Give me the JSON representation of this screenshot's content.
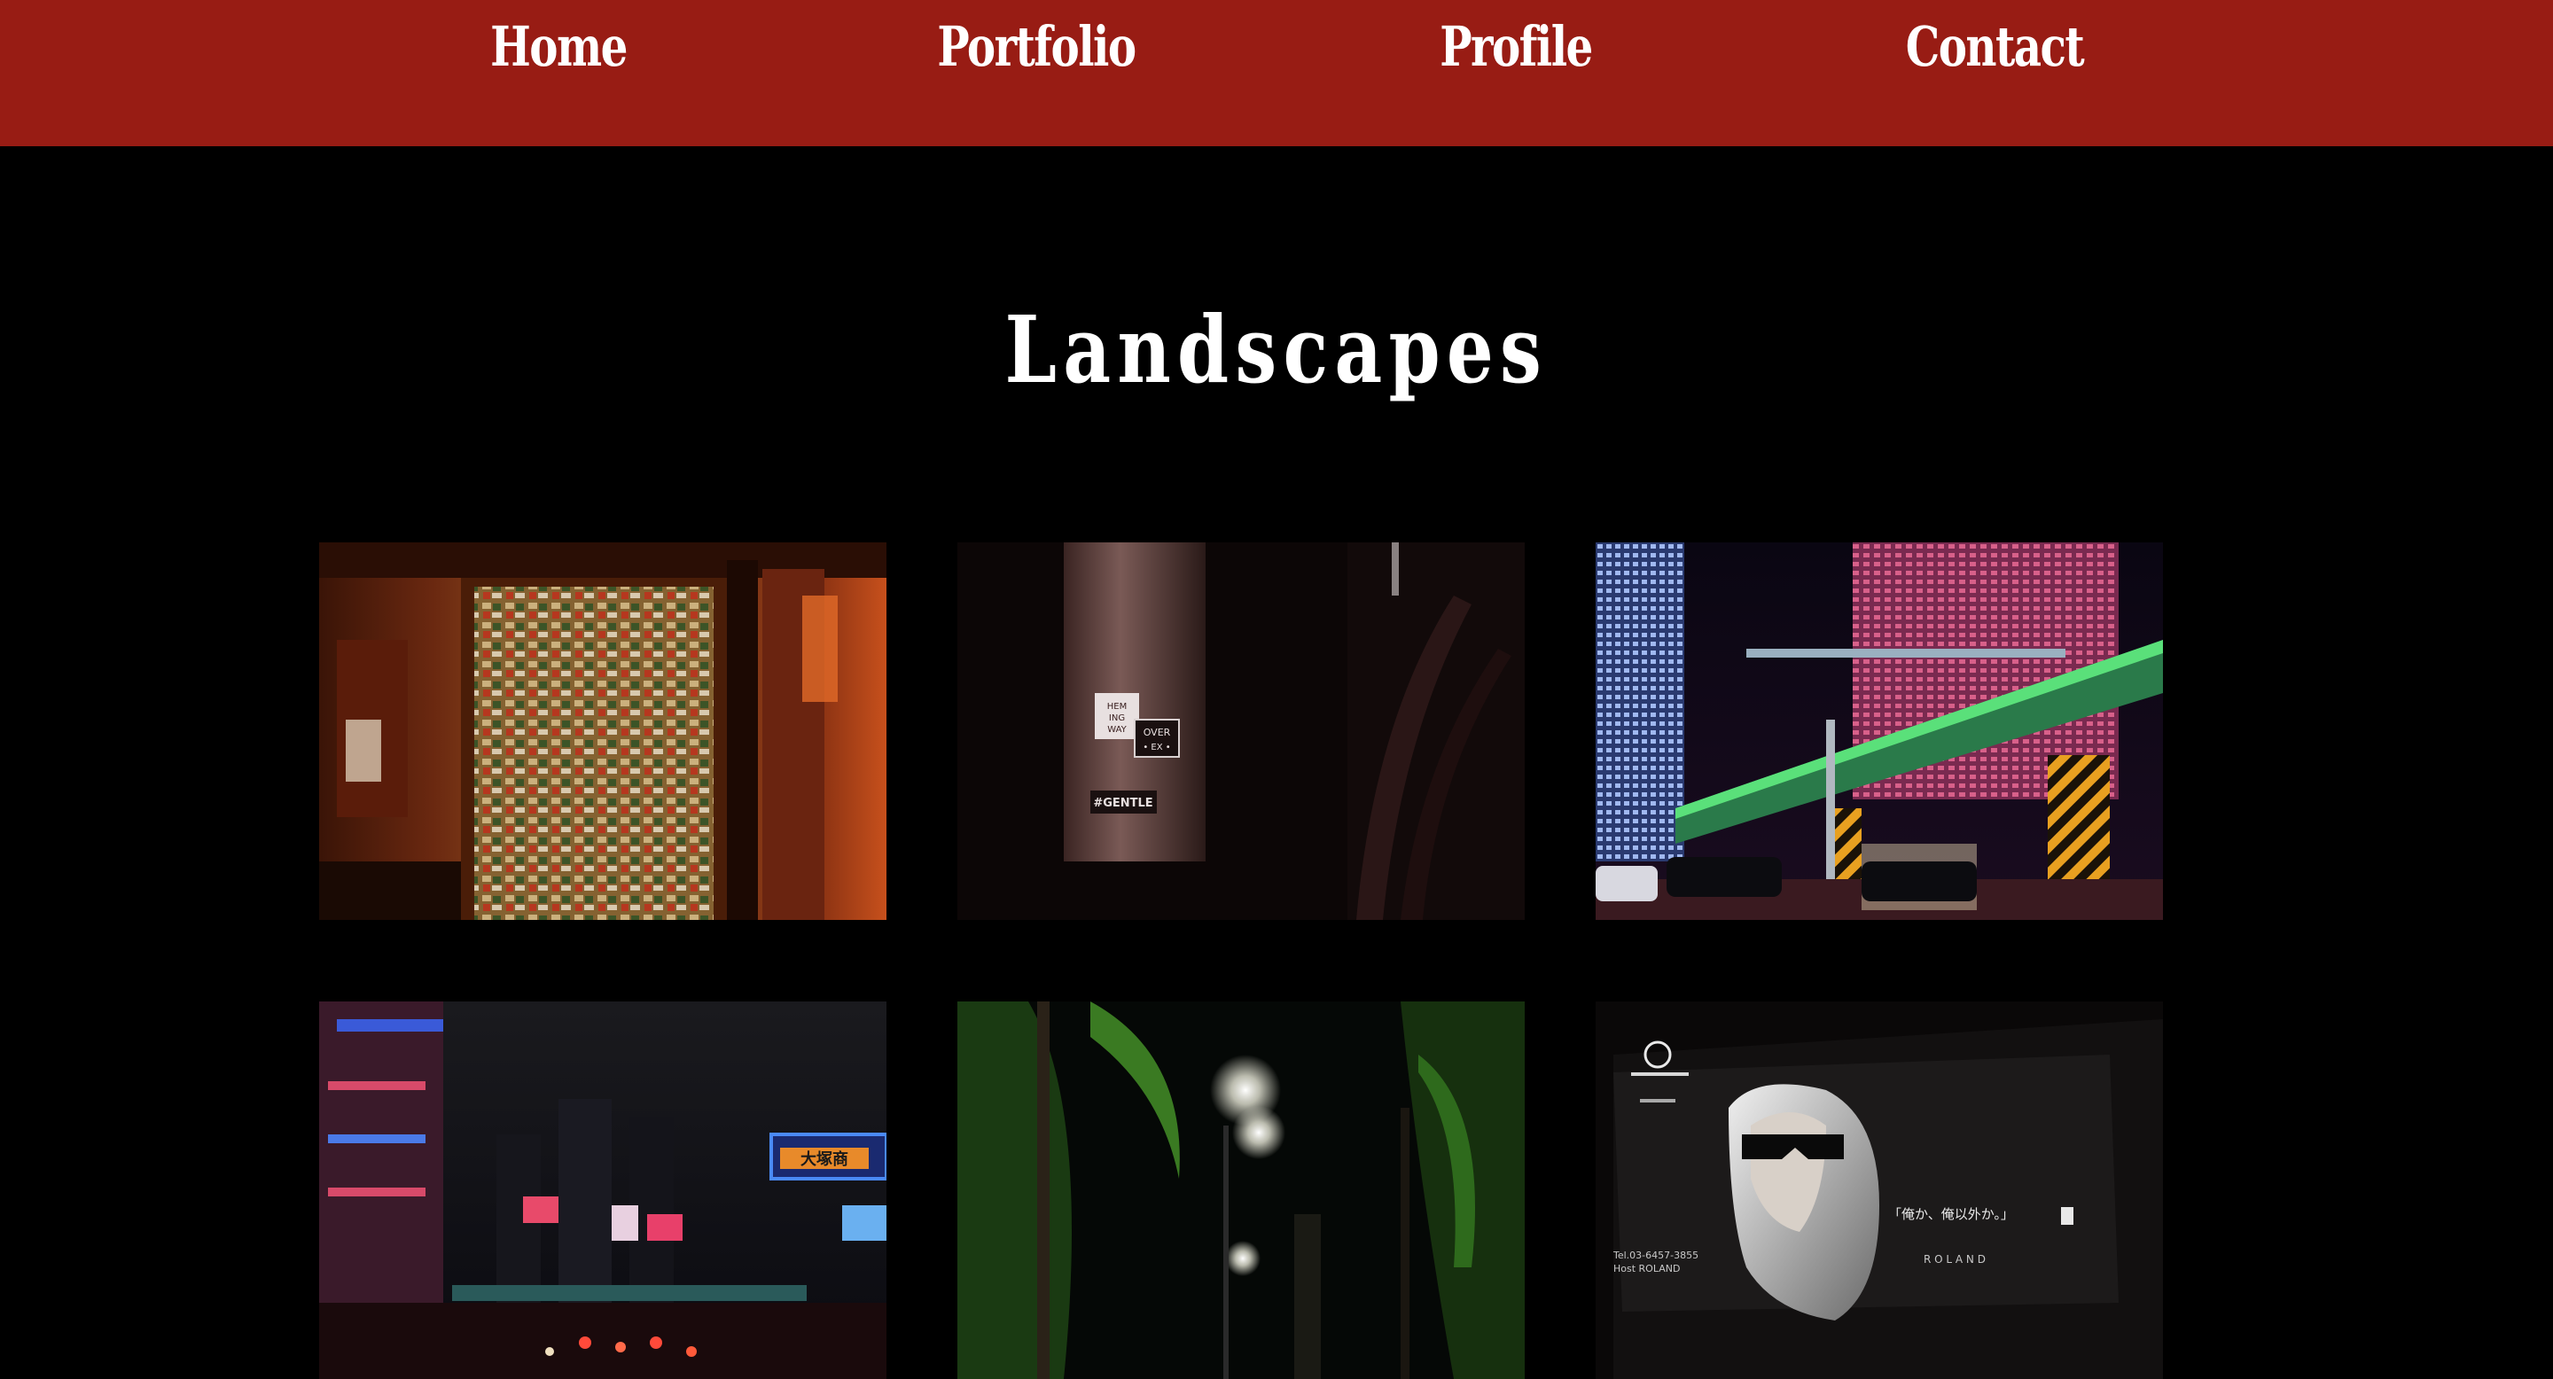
{
  "nav": {
    "items": [
      {
        "label": "Home"
      },
      {
        "label": "Portfolio"
      },
      {
        "label": "Profile"
      },
      {
        "label": "Contact"
      }
    ]
  },
  "page": {
    "title": "Landscapes"
  },
  "gallery": {
    "photos": [
      {
        "subject": "sticker-covered wall in warm-lit bar"
      },
      {
        "subject": "sticker on dark pipe",
        "stickers": [
          "HEM",
          "ING",
          "WAY",
          "OVER",
          "• EX •",
          "#GENTLE"
        ]
      },
      {
        "subject": "night city with elevated railway bridge"
      },
      {
        "subject": "night street with neon signs",
        "sign_text": "大塚商"
      },
      {
        "subject": "street lamps among trees at night"
      },
      {
        "subject": "billboard with woman in sunglasses",
        "billboard_text": [
          "Tel.03-6457-3855",
          "Host ROLAND",
          "「俺か、俺以外か。」",
          "R O L A N D"
        ]
      }
    ]
  },
  "colors": {
    "nav_background": "#981c14",
    "page_background": "#000000",
    "text": "#ffffff"
  }
}
